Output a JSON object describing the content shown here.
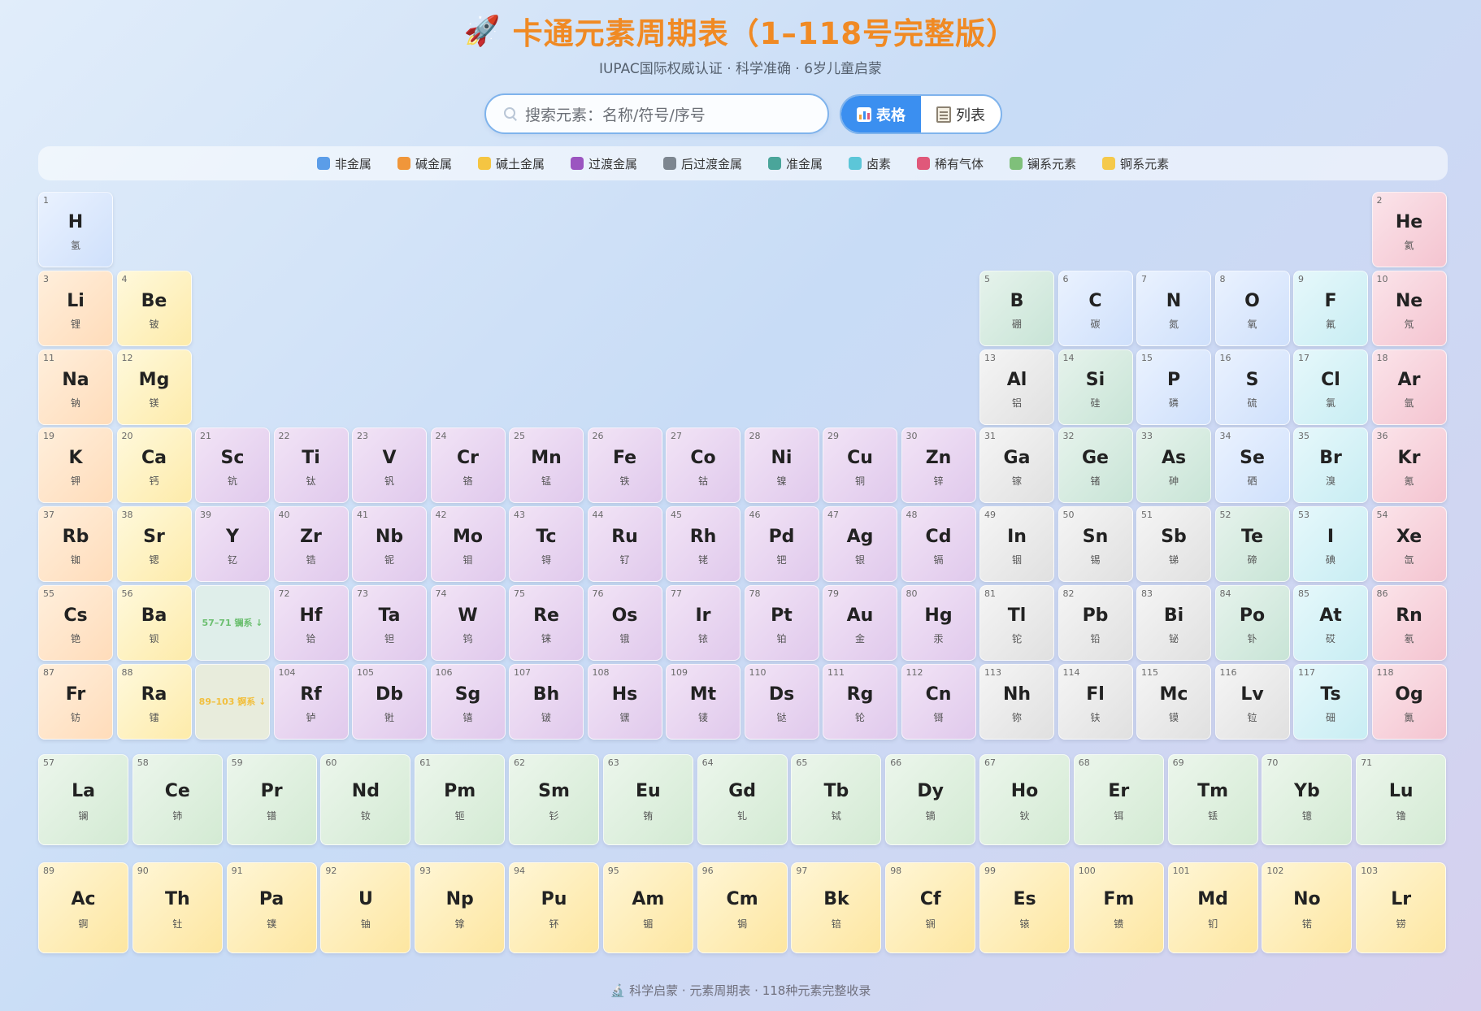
{
  "header": {
    "title": "卡通元素周期表（1–118号完整版）",
    "subtitle": "IUPAC国际权威认证 · 科学准确 · 6岁儿童启蒙",
    "icon": "rocket-icon"
  },
  "search": {
    "placeholder": "搜索元素：名称/符号/序号"
  },
  "view_toggle": {
    "table_label": "表格",
    "list_label": "列表",
    "active": "table"
  },
  "legend": [
    {
      "label": "非金属",
      "color": "#5b9de8"
    },
    {
      "label": "碱金属",
      "color": "#f0963a"
    },
    {
      "label": "碱土金属",
      "color": "#f5c542"
    },
    {
      "label": "过渡金属",
      "color": "#9b55c0"
    },
    {
      "label": "后过渡金属",
      "color": "#7d8690"
    },
    {
      "label": "准金属",
      "color": "#4aa59a"
    },
    {
      "label": "卤素",
      "color": "#5cc6d8"
    },
    {
      "label": "稀有气体",
      "color": "#e0587a"
    },
    {
      "label": "镧系元素",
      "color": "#7fc07a"
    },
    {
      "label": "锕系元素",
      "color": "#f5c94a"
    }
  ],
  "elements": [
    {
      "n": "1",
      "s": "H",
      "c": "氢",
      "cat": "nonmetal"
    },
    {
      "n": "2",
      "s": "He",
      "c": "氦",
      "cat": "noble"
    },
    {
      "n": "3",
      "s": "Li",
      "c": "锂",
      "cat": "alkali"
    },
    {
      "n": "4",
      "s": "Be",
      "c": "铍",
      "cat": "alkaline"
    },
    {
      "n": "5",
      "s": "B",
      "c": "硼",
      "cat": "metalloid"
    },
    {
      "n": "6",
      "s": "C",
      "c": "碳",
      "cat": "nonmetal"
    },
    {
      "n": "7",
      "s": "N",
      "c": "氮",
      "cat": "nonmetal"
    },
    {
      "n": "8",
      "s": "O",
      "c": "氧",
      "cat": "nonmetal"
    },
    {
      "n": "9",
      "s": "F",
      "c": "氟",
      "cat": "halogen"
    },
    {
      "n": "10",
      "s": "Ne",
      "c": "氖",
      "cat": "noble"
    },
    {
      "n": "11",
      "s": "Na",
      "c": "钠",
      "cat": "alkali"
    },
    {
      "n": "12",
      "s": "Mg",
      "c": "镁",
      "cat": "alkaline"
    },
    {
      "n": "13",
      "s": "Al",
      "c": "铝",
      "cat": "post"
    },
    {
      "n": "14",
      "s": "Si",
      "c": "硅",
      "cat": "metalloid"
    },
    {
      "n": "15",
      "s": "P",
      "c": "磷",
      "cat": "nonmetal"
    },
    {
      "n": "16",
      "s": "S",
      "c": "硫",
      "cat": "nonmetal"
    },
    {
      "n": "17",
      "s": "Cl",
      "c": "氯",
      "cat": "halogen"
    },
    {
      "n": "18",
      "s": "Ar",
      "c": "氩",
      "cat": "noble"
    },
    {
      "n": "19",
      "s": "K",
      "c": "钾",
      "cat": "alkali"
    },
    {
      "n": "20",
      "s": "Ca",
      "c": "钙",
      "cat": "alkaline"
    },
    {
      "n": "21",
      "s": "Sc",
      "c": "钪",
      "cat": "transition"
    },
    {
      "n": "22",
      "s": "Ti",
      "c": "钛",
      "cat": "transition"
    },
    {
      "n": "23",
      "s": "V",
      "c": "钒",
      "cat": "transition"
    },
    {
      "n": "24",
      "s": "Cr",
      "c": "铬",
      "cat": "transition"
    },
    {
      "n": "25",
      "s": "Mn",
      "c": "锰",
      "cat": "transition"
    },
    {
      "n": "26",
      "s": "Fe",
      "c": "铁",
      "cat": "transition"
    },
    {
      "n": "27",
      "s": "Co",
      "c": "钴",
      "cat": "transition"
    },
    {
      "n": "28",
      "s": "Ni",
      "c": "镍",
      "cat": "transition"
    },
    {
      "n": "29",
      "s": "Cu",
      "c": "铜",
      "cat": "transition"
    },
    {
      "n": "30",
      "s": "Zn",
      "c": "锌",
      "cat": "transition"
    },
    {
      "n": "31",
      "s": "Ga",
      "c": "镓",
      "cat": "post"
    },
    {
      "n": "32",
      "s": "Ge",
      "c": "锗",
      "cat": "metalloid"
    },
    {
      "n": "33",
      "s": "As",
      "c": "砷",
      "cat": "metalloid"
    },
    {
      "n": "34",
      "s": "Se",
      "c": "硒",
      "cat": "nonmetal"
    },
    {
      "n": "35",
      "s": "Br",
      "c": "溴",
      "cat": "halogen"
    },
    {
      "n": "36",
      "s": "Kr",
      "c": "氪",
      "cat": "noble"
    },
    {
      "n": "37",
      "s": "Rb",
      "c": "铷",
      "cat": "alkali"
    },
    {
      "n": "38",
      "s": "Sr",
      "c": "锶",
      "cat": "alkaline"
    },
    {
      "n": "39",
      "s": "Y",
      "c": "钇",
      "cat": "transition"
    },
    {
      "n": "40",
      "s": "Zr",
      "c": "锆",
      "cat": "transition"
    },
    {
      "n": "41",
      "s": "Nb",
      "c": "铌",
      "cat": "transition"
    },
    {
      "n": "42",
      "s": "Mo",
      "c": "钼",
      "cat": "transition"
    },
    {
      "n": "43",
      "s": "Tc",
      "c": "锝",
      "cat": "transition"
    },
    {
      "n": "44",
      "s": "Ru",
      "c": "钌",
      "cat": "transition"
    },
    {
      "n": "45",
      "s": "Rh",
      "c": "铑",
      "cat": "transition"
    },
    {
      "n": "46",
      "s": "Pd",
      "c": "钯",
      "cat": "transition"
    },
    {
      "n": "47",
      "s": "Ag",
      "c": "银",
      "cat": "transition"
    },
    {
      "n": "48",
      "s": "Cd",
      "c": "镉",
      "cat": "transition"
    },
    {
      "n": "49",
      "s": "In",
      "c": "铟",
      "cat": "post"
    },
    {
      "n": "50",
      "s": "Sn",
      "c": "锡",
      "cat": "post"
    },
    {
      "n": "51",
      "s": "Sb",
      "c": "锑",
      "cat": "post"
    },
    {
      "n": "52",
      "s": "Te",
      "c": "碲",
      "cat": "metalloid"
    },
    {
      "n": "53",
      "s": "I",
      "c": "碘",
      "cat": "halogen"
    },
    {
      "n": "54",
      "s": "Xe",
      "c": "氙",
      "cat": "noble"
    },
    {
      "n": "55",
      "s": "Cs",
      "c": "铯",
      "cat": "alkali"
    },
    {
      "n": "56",
      "s": "Ba",
      "c": "钡",
      "cat": "alkaline"
    },
    {
      "n": "",
      "s": "57–71 镧系 ↓",
      "c": "",
      "cat": "phl"
    },
    {
      "n": "72",
      "s": "Hf",
      "c": "铪",
      "cat": "transition"
    },
    {
      "n": "73",
      "s": "Ta",
      "c": "钽",
      "cat": "transition"
    },
    {
      "n": "74",
      "s": "W",
      "c": "钨",
      "cat": "transition"
    },
    {
      "n": "75",
      "s": "Re",
      "c": "铼",
      "cat": "transition"
    },
    {
      "n": "76",
      "s": "Os",
      "c": "锇",
      "cat": "transition"
    },
    {
      "n": "77",
      "s": "Ir",
      "c": "铱",
      "cat": "transition"
    },
    {
      "n": "78",
      "s": "Pt",
      "c": "铂",
      "cat": "transition"
    },
    {
      "n": "79",
      "s": "Au",
      "c": "金",
      "cat": "transition"
    },
    {
      "n": "80",
      "s": "Hg",
      "c": "汞",
      "cat": "transition"
    },
    {
      "n": "81",
      "s": "Tl",
      "c": "铊",
      "cat": "post"
    },
    {
      "n": "82",
      "s": "Pb",
      "c": "铅",
      "cat": "post"
    },
    {
      "n": "83",
      "s": "Bi",
      "c": "铋",
      "cat": "post"
    },
    {
      "n": "84",
      "s": "Po",
      "c": "钋",
      "cat": "metalloid"
    },
    {
      "n": "85",
      "s": "At",
      "c": "砹",
      "cat": "halogen"
    },
    {
      "n": "86",
      "s": "Rn",
      "c": "氡",
      "cat": "noble"
    },
    {
      "n": "87",
      "s": "Fr",
      "c": "钫",
      "cat": "alkali"
    },
    {
      "n": "88",
      "s": "Ra",
      "c": "镭",
      "cat": "alkaline"
    },
    {
      "n": "",
      "s": "89–103 锕系 ↓",
      "c": "",
      "cat": "pha"
    },
    {
      "n": "104",
      "s": "Rf",
      "c": "𬬻",
      "cat": "transition"
    },
    {
      "n": "105",
      "s": "Db",
      "c": "𬭊",
      "cat": "transition"
    },
    {
      "n": "106",
      "s": "Sg",
      "c": "𬭳",
      "cat": "transition"
    },
    {
      "n": "107",
      "s": "Bh",
      "c": "𬭛",
      "cat": "transition"
    },
    {
      "n": "108",
      "s": "Hs",
      "c": "𬭶",
      "cat": "transition"
    },
    {
      "n": "109",
      "s": "Mt",
      "c": "鿏",
      "cat": "transition"
    },
    {
      "n": "110",
      "s": "Ds",
      "c": "𫟼",
      "cat": "transition"
    },
    {
      "n": "111",
      "s": "Rg",
      "c": "𬬭",
      "cat": "transition"
    },
    {
      "n": "112",
      "s": "Cn",
      "c": "鿔",
      "cat": "transition"
    },
    {
      "n": "113",
      "s": "Nh",
      "c": "鿭",
      "cat": "post"
    },
    {
      "n": "114",
      "s": "Fl",
      "c": "𫓧",
      "cat": "post"
    },
    {
      "n": "115",
      "s": "Mc",
      "c": "镆",
      "cat": "post"
    },
    {
      "n": "116",
      "s": "Lv",
      "c": "𫟷",
      "cat": "post"
    },
    {
      "n": "117",
      "s": "Ts",
      "c": "鿬",
      "cat": "halogen"
    },
    {
      "n": "118",
      "s": "Og",
      "c": "鿫",
      "cat": "noble"
    }
  ],
  "lanthanides": [
    {
      "n": "57",
      "s": "La",
      "c": "镧"
    },
    {
      "n": "58",
      "s": "Ce",
      "c": "铈"
    },
    {
      "n": "59",
      "s": "Pr",
      "c": "镨"
    },
    {
      "n": "60",
      "s": "Nd",
      "c": "钕"
    },
    {
      "n": "61",
      "s": "Pm",
      "c": "钷"
    },
    {
      "n": "62",
      "s": "Sm",
      "c": "钐"
    },
    {
      "n": "63",
      "s": "Eu",
      "c": "铕"
    },
    {
      "n": "64",
      "s": "Gd",
      "c": "钆"
    },
    {
      "n": "65",
      "s": "Tb",
      "c": "铽"
    },
    {
      "n": "66",
      "s": "Dy",
      "c": "镝"
    },
    {
      "n": "67",
      "s": "Ho",
      "c": "钬"
    },
    {
      "n": "68",
      "s": "Er",
      "c": "铒"
    },
    {
      "n": "69",
      "s": "Tm",
      "c": "铥"
    },
    {
      "n": "70",
      "s": "Yb",
      "c": "镱"
    },
    {
      "n": "71",
      "s": "Lu",
      "c": "镥"
    }
  ],
  "actinides": [
    {
      "n": "89",
      "s": "Ac",
      "c": "锕"
    },
    {
      "n": "90",
      "s": "Th",
      "c": "钍"
    },
    {
      "n": "91",
      "s": "Pa",
      "c": "镤"
    },
    {
      "n": "92",
      "s": "U",
      "c": "铀"
    },
    {
      "n": "93",
      "s": "Np",
      "c": "镎"
    },
    {
      "n": "94",
      "s": "Pu",
      "c": "钚"
    },
    {
      "n": "95",
      "s": "Am",
      "c": "镅"
    },
    {
      "n": "96",
      "s": "Cm",
      "c": "锔"
    },
    {
      "n": "97",
      "s": "Bk",
      "c": "锫"
    },
    {
      "n": "98",
      "s": "Cf",
      "c": "锎"
    },
    {
      "n": "99",
      "s": "Es",
      "c": "锿"
    },
    {
      "n": "100",
      "s": "Fm",
      "c": "镄"
    },
    {
      "n": "101",
      "s": "Md",
      "c": "钔"
    },
    {
      "n": "102",
      "s": "No",
      "c": "锘"
    },
    {
      "n": "103",
      "s": "Lr",
      "c": "铹"
    }
  ],
  "footer": {
    "text": "科学启蒙 · 元素周期表 · 118种元素完整收录",
    "icon": "microscope-icon"
  }
}
